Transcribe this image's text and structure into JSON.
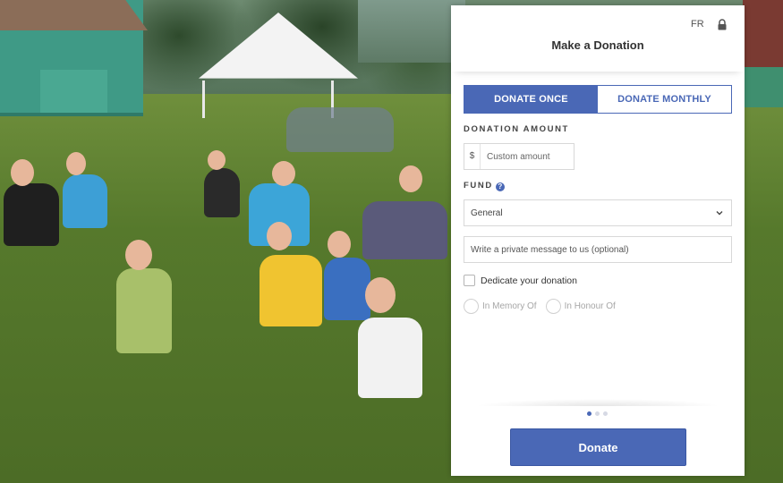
{
  "header": {
    "language_toggle": "FR",
    "title": "Make a Donation"
  },
  "frequency_tabs": [
    {
      "label": "DONATE ONCE",
      "active": true
    },
    {
      "label": "DONATE MONTHLY",
      "active": false
    }
  ],
  "amount": {
    "label": "DONATION AMOUNT",
    "currency_symbol": "$",
    "placeholder": "Custom amount",
    "value": ""
  },
  "fund": {
    "label": "FUND",
    "help_glyph": "?",
    "selected": "General"
  },
  "message": {
    "placeholder": "Write a private message to us (optional)",
    "value": ""
  },
  "dedication": {
    "checkbox_label": "Dedicate your donation",
    "checked": false,
    "options": [
      {
        "label": "In Memory Of",
        "selected": false
      },
      {
        "label": "In Honour Of",
        "selected": false
      }
    ]
  },
  "pagination": {
    "current_step": 1,
    "total_steps": 3
  },
  "donate_button": {
    "label": "Donate"
  },
  "icons": {
    "lock": "lock-icon",
    "chevron": "chevron-down-icon",
    "help": "help-icon"
  },
  "colors": {
    "accent": "#4a68b6",
    "text": "#333333",
    "muted": "#a6a6a6",
    "border": "#d8d8d8"
  }
}
